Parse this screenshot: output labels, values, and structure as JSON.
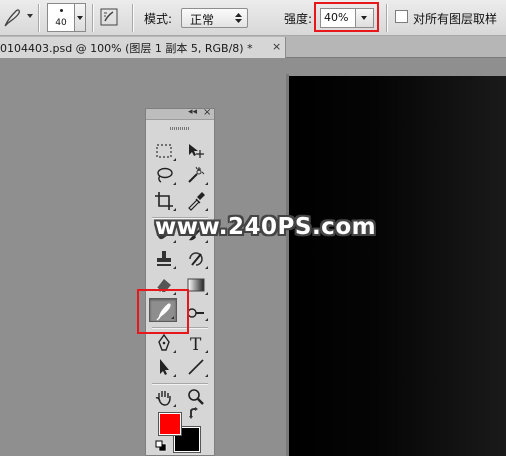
{
  "options_bar": {
    "brush_size": "40",
    "mode_label": "模式:",
    "mode_value": "正常",
    "strength_label": "强度:",
    "strength_value": "40%",
    "sample_all_layers_label": "对所有图层取样",
    "sample_all_layers_checked": false,
    "highlight_color": "#e8171b"
  },
  "document_tab": {
    "title": "0104403.psd @ 100% (图层 1 副本 5, RGB/8) *",
    "close_label": "×"
  },
  "toolbox": {
    "collapse_label": "◂◂",
    "close_label": "×",
    "tools": [
      {
        "name": "rectangular-marquee-icon"
      },
      {
        "name": "move-icon"
      },
      {
        "name": "lasso-icon"
      },
      {
        "name": "magic-wand-icon"
      },
      {
        "name": "crop-icon"
      },
      {
        "name": "eyedropper-icon"
      },
      {
        "name": "healing-brush-icon"
      },
      {
        "name": "brush-icon"
      },
      {
        "name": "clone-stamp-icon"
      },
      {
        "name": "history-brush-icon"
      },
      {
        "name": "eraser-icon"
      },
      {
        "name": "gradient-icon"
      },
      {
        "name": "blur-icon",
        "active": true
      },
      {
        "name": "dodge-icon"
      },
      {
        "name": "pen-icon"
      },
      {
        "name": "type-icon",
        "label": "T"
      },
      {
        "name": "path-selection-icon"
      },
      {
        "name": "line-icon"
      },
      {
        "name": "hand-icon"
      },
      {
        "name": "zoom-icon"
      }
    ],
    "foreground_color": "#ff0000",
    "background_color": "#000000"
  },
  "watermark": "www.240PS.com"
}
